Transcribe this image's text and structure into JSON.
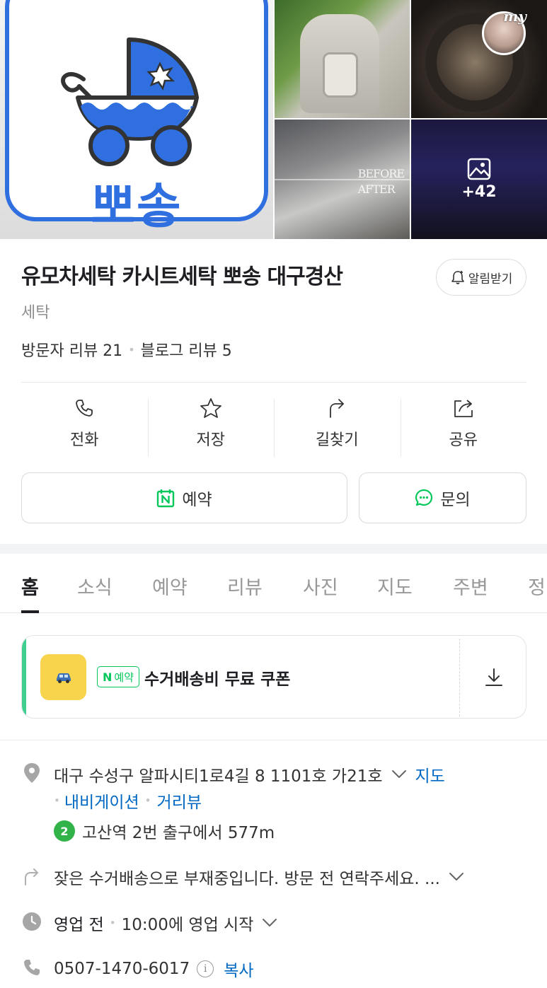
{
  "gallery": {
    "logo_text": "뽀송",
    "more_count": "+42",
    "my_label": "my",
    "before_label": "BEFORE",
    "after_label": "AFTER"
  },
  "place": {
    "title": "유모차세탁 카시트세탁 뽀송 대구경산",
    "category": "세탁",
    "alarm_label": "알림받기",
    "visitor_reviews": "방문자 리뷰 21",
    "blog_reviews": "블로그 리뷰 5"
  },
  "actions": [
    {
      "label": "전화",
      "icon": "phone-icon"
    },
    {
      "label": "저장",
      "icon": "star-icon"
    },
    {
      "label": "길찾기",
      "icon": "directions-icon"
    },
    {
      "label": "공유",
      "icon": "share-icon"
    }
  ],
  "buttons": {
    "reserve_label": "예약",
    "inquiry_label": "문의"
  },
  "tabs": [
    "홈",
    "소식",
    "예약",
    "리뷰",
    "사진",
    "지도",
    "주변",
    "정"
  ],
  "active_tab": "홈",
  "coupon": {
    "badge_n": "N",
    "badge_label": "예약",
    "text": "수거배송비 무료 쿠폰"
  },
  "info": {
    "address": "대구 수성구 알파시티1로4길 8 1101호 가21호",
    "map_link": "지도",
    "navigation_link": "내비게이션",
    "street_view_link": "거리뷰",
    "subway_line": "2",
    "subway_text": "고산역 2번 출구에서 577m",
    "notice": "잦은 수거배송으로 부재중입니다. 방문 전 연락주세요. ...",
    "hours_status": "영업 전",
    "hours_text": "10:00에 영업 시작",
    "phone": "0507-1470-6017",
    "copy_label": "복사"
  },
  "colors": {
    "accent_green": "#03c75a",
    "link_blue": "#0068c3",
    "logo_blue": "#2f6fe0",
    "subway_green": "#32b34a",
    "coupon_yellow": "#f8d44c"
  }
}
